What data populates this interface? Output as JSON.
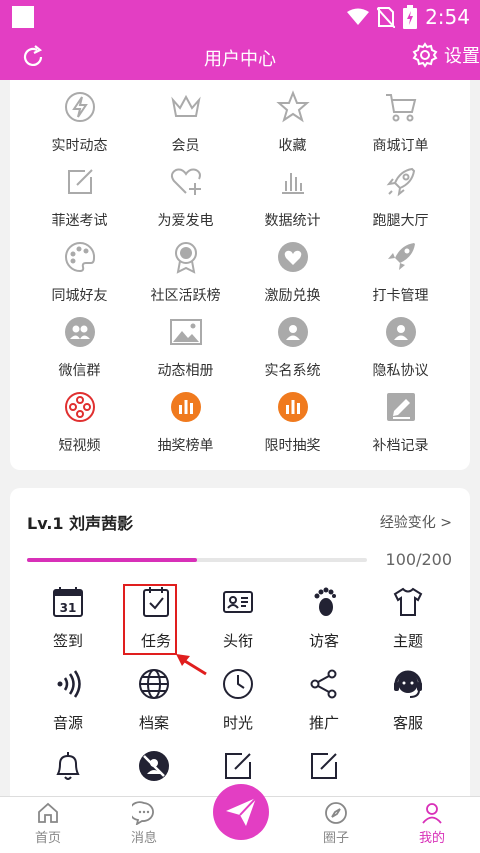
{
  "status": {
    "time": "2:54",
    "icons": [
      "wifi-icon",
      "no-sim-icon",
      "battery-charging-icon"
    ]
  },
  "header": {
    "title": "用户中心",
    "settings_label": "设置"
  },
  "colors": {
    "accent": "#e33ec3",
    "highlight": "#e01e1e"
  },
  "features": [
    {
      "label": "实时动态",
      "icon": "lightning-icon"
    },
    {
      "label": "会员",
      "icon": "crown-icon"
    },
    {
      "label": "收藏",
      "icon": "star-icon"
    },
    {
      "label": "商城订单",
      "icon": "cart-icon"
    },
    {
      "label": "菲迷考试",
      "icon": "edit-icon"
    },
    {
      "label": "为爱发电",
      "icon": "heart-plus-icon"
    },
    {
      "label": "数据统计",
      "icon": "bar-chart-icon"
    },
    {
      "label": "跑腿大厅",
      "icon": "rocket-icon"
    },
    {
      "label": "同城好友",
      "icon": "palette-icon"
    },
    {
      "label": "社区活跃榜",
      "icon": "medal-icon"
    },
    {
      "label": "激励兑换",
      "icon": "heart-circle-icon"
    },
    {
      "label": "打卡管理",
      "icon": "rocket-solid-icon"
    },
    {
      "label": "微信群",
      "icon": "group-icon"
    },
    {
      "label": "动态相册",
      "icon": "image-icon"
    },
    {
      "label": "实名系统",
      "icon": "user-circle-icon"
    },
    {
      "label": "隐私协议",
      "icon": "user-circle-icon"
    },
    {
      "label": "短视频",
      "icon": "film-reel-icon"
    },
    {
      "label": "抽奖榜单",
      "icon": "chart-circle-icon"
    },
    {
      "label": "限时抽奖",
      "icon": "chart-circle-icon"
    },
    {
      "label": "补档记录",
      "icon": "pencil-square-icon"
    }
  ],
  "profile": {
    "title": "Lv.1 刘声茜影",
    "exp_link": "经验变化 >",
    "progress_text": "100/200",
    "progress": 0.5
  },
  "tools": [
    {
      "label": "签到",
      "icon": "calendar-icon",
      "day": "31"
    },
    {
      "label": "任务",
      "icon": "task-icon"
    },
    {
      "label": "头衔",
      "icon": "id-card-icon"
    },
    {
      "label": "访客",
      "icon": "footprint-icon"
    },
    {
      "label": "主题",
      "icon": "shirt-icon"
    },
    {
      "label": "音源",
      "icon": "sound-icon"
    },
    {
      "label": "档案",
      "icon": "globe-icon"
    },
    {
      "label": "时光",
      "icon": "clock-icon"
    },
    {
      "label": "推广",
      "icon": "share-icon"
    },
    {
      "label": "客服",
      "icon": "headset-icon"
    },
    {
      "label": "",
      "icon": "bell-icon"
    },
    {
      "label": "",
      "icon": "blocked-user-icon"
    },
    {
      "label": "",
      "icon": "edit-icon"
    },
    {
      "label": "",
      "icon": "edit-icon"
    }
  ],
  "nav": [
    {
      "label": "首页",
      "icon": "home-icon"
    },
    {
      "label": "消息",
      "icon": "chat-icon"
    },
    {
      "label": "",
      "icon": "paper-plane-icon"
    },
    {
      "label": "圈子",
      "icon": "compass-icon"
    },
    {
      "label": "我的",
      "icon": "user-icon"
    }
  ]
}
